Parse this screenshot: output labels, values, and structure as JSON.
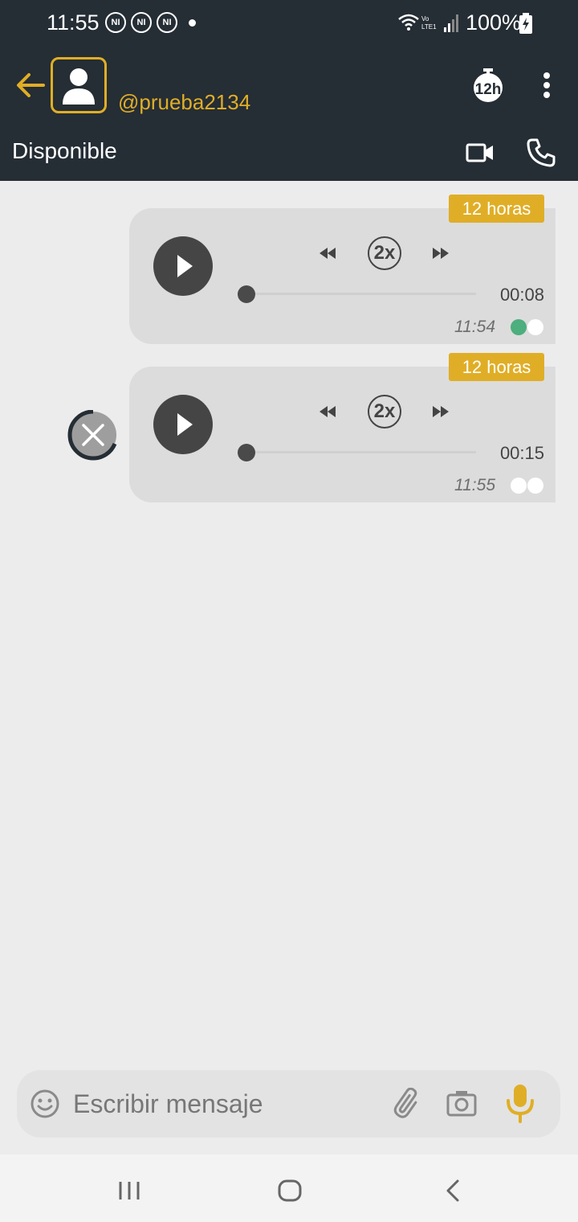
{
  "status_bar": {
    "time": "11:55",
    "notifications": [
      "NI",
      "NI",
      "NI"
    ],
    "battery": "100%"
  },
  "header": {
    "username": "@prueba2134",
    "status": "Disponible",
    "timer_label": "12h",
    "accent_color": "#e0ae26",
    "background": "#252d35"
  },
  "messages": [
    {
      "expiry_badge": "12 horas",
      "speed": "2x",
      "duration": "00:08",
      "time": "11:54",
      "ticks": [
        "#4caf7d",
        "#ffffff"
      ],
      "progress": 0
    },
    {
      "expiry_badge": "12 horas",
      "speed": "2x",
      "duration": "00:15",
      "time": "11:55",
      "ticks": [
        "#ffffff",
        "#ffffff"
      ],
      "progress": 0,
      "uploading": true
    }
  ],
  "composer": {
    "placeholder": "Escribir mensaje"
  }
}
